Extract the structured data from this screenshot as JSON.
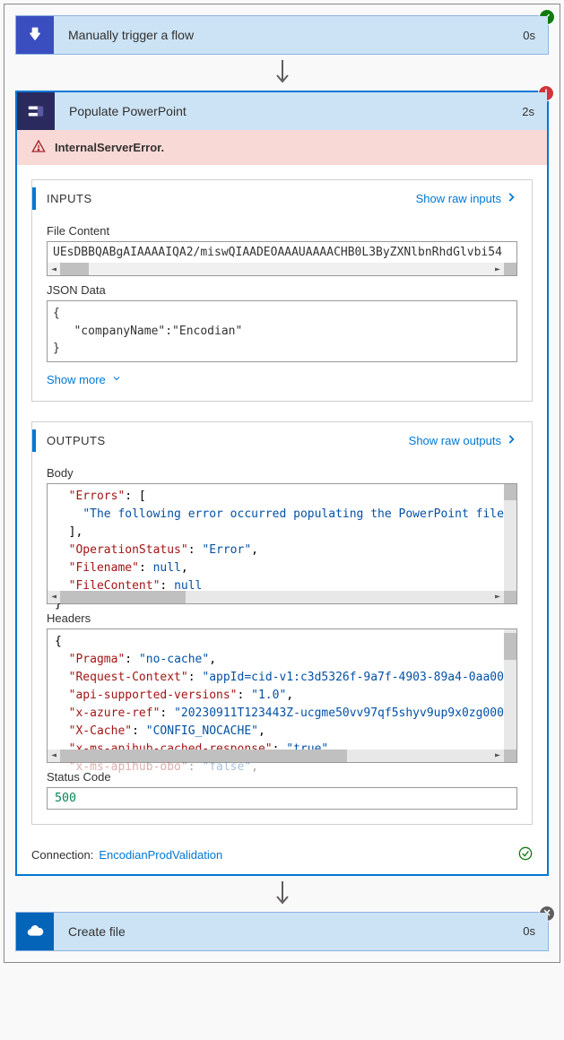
{
  "steps": {
    "trigger": {
      "title": "Manually trigger a flow",
      "duration": "0s",
      "status": "success"
    },
    "populate": {
      "title": "Populate PowerPoint",
      "duration": "2s",
      "status": "error"
    },
    "createFile": {
      "title": "Create file",
      "duration": "0s",
      "status": "neutral"
    }
  },
  "error": {
    "message": "InternalServerError."
  },
  "panels": {
    "inputs": {
      "title": "INPUTS",
      "rawLink": "Show raw inputs"
    },
    "outputs": {
      "title": "OUTPUTS",
      "rawLink": "Show raw outputs"
    }
  },
  "inputs": {
    "fileContentLabel": "File Content",
    "fileContentValue": "UEsDBBQABgAIAAAAIQA2/miswQIAADEOAAAUAAAACHB0L3ByZXNlbnRhdGlvbi54",
    "jsonDataLabel": "JSON Data",
    "jsonLines": [
      "{",
      "   \"companyName\":\"Encodian\"",
      "}"
    ],
    "showMoreLabel": "Show more"
  },
  "outputs": {
    "bodyLabel": "Body",
    "body": {
      "Errors": [
        "The following error occurred populating the PowerPoint file"
      ],
      "OperationStatus": "Error",
      "Filename": null,
      "FileContent": null
    },
    "chart_note": "Body rendered as JSON fragment with opening brace above visible area and closing brace visible; horizontal scroll visible.",
    "headersLabel": "Headers",
    "headers": {
      "Pragma": "no-cache",
      "Request-Context": "appId=cid-v1:c3d5326f-9a7f-4903-89a4-0aa00",
      "api-supported-versions": "1.0",
      "x-azure-ref": "20230911T123443Z-ucgme50vv97qf5shyv9up9x0zg000",
      "X-Cache": "CONFIG_NOCACHE",
      "x-ms-apihub-cached-response": "true",
      "x-ms-apihub-obo": "false"
    },
    "statusCodeLabel": "Status Code",
    "statusCode": "500"
  },
  "connection": {
    "label": "Connection:",
    "name": "EncodianProdValidation"
  }
}
